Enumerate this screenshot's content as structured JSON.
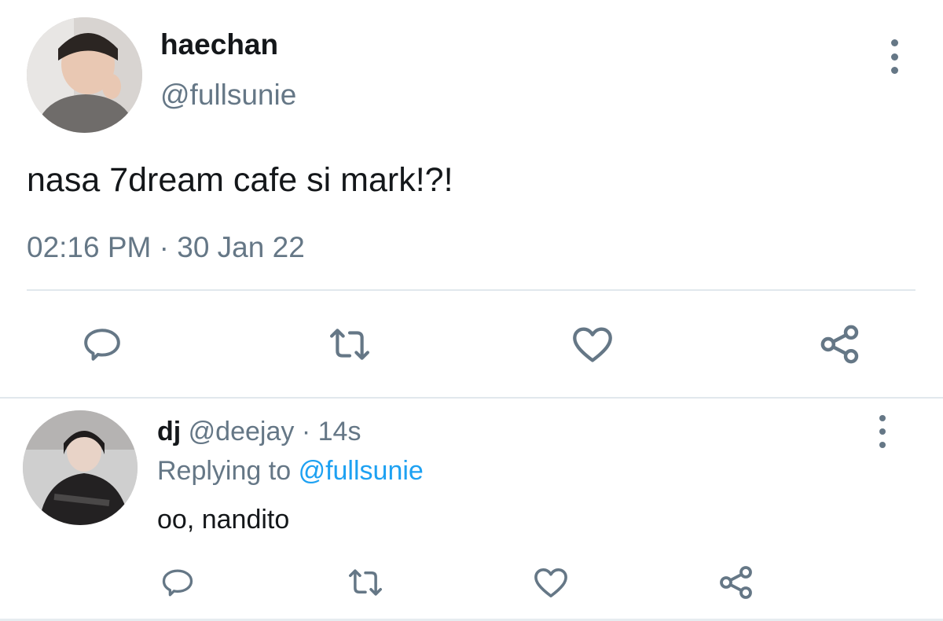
{
  "tweet": {
    "display_name": "haechan",
    "handle": "@fullsunie",
    "text": "nasa 7dream cafe si mark!?!",
    "timestamp": "02:16 PM · 30 Jan 22"
  },
  "reply": {
    "display_name": "dj",
    "handle": "@deejay",
    "separator": "·",
    "time_ago": "14s",
    "replying_prefix": "Replying to",
    "replying_handle": "@fullsunie",
    "text": "oo, nandito"
  },
  "actions": [
    "reply-icon",
    "retweet-icon",
    "like-icon",
    "share-icon"
  ],
  "icons": {
    "more": "more-vertical-icon"
  },
  "colors": {
    "text_primary": "#14171a",
    "text_secondary": "#657786",
    "link": "#1da1f2",
    "divider": "#e1e8ed"
  }
}
